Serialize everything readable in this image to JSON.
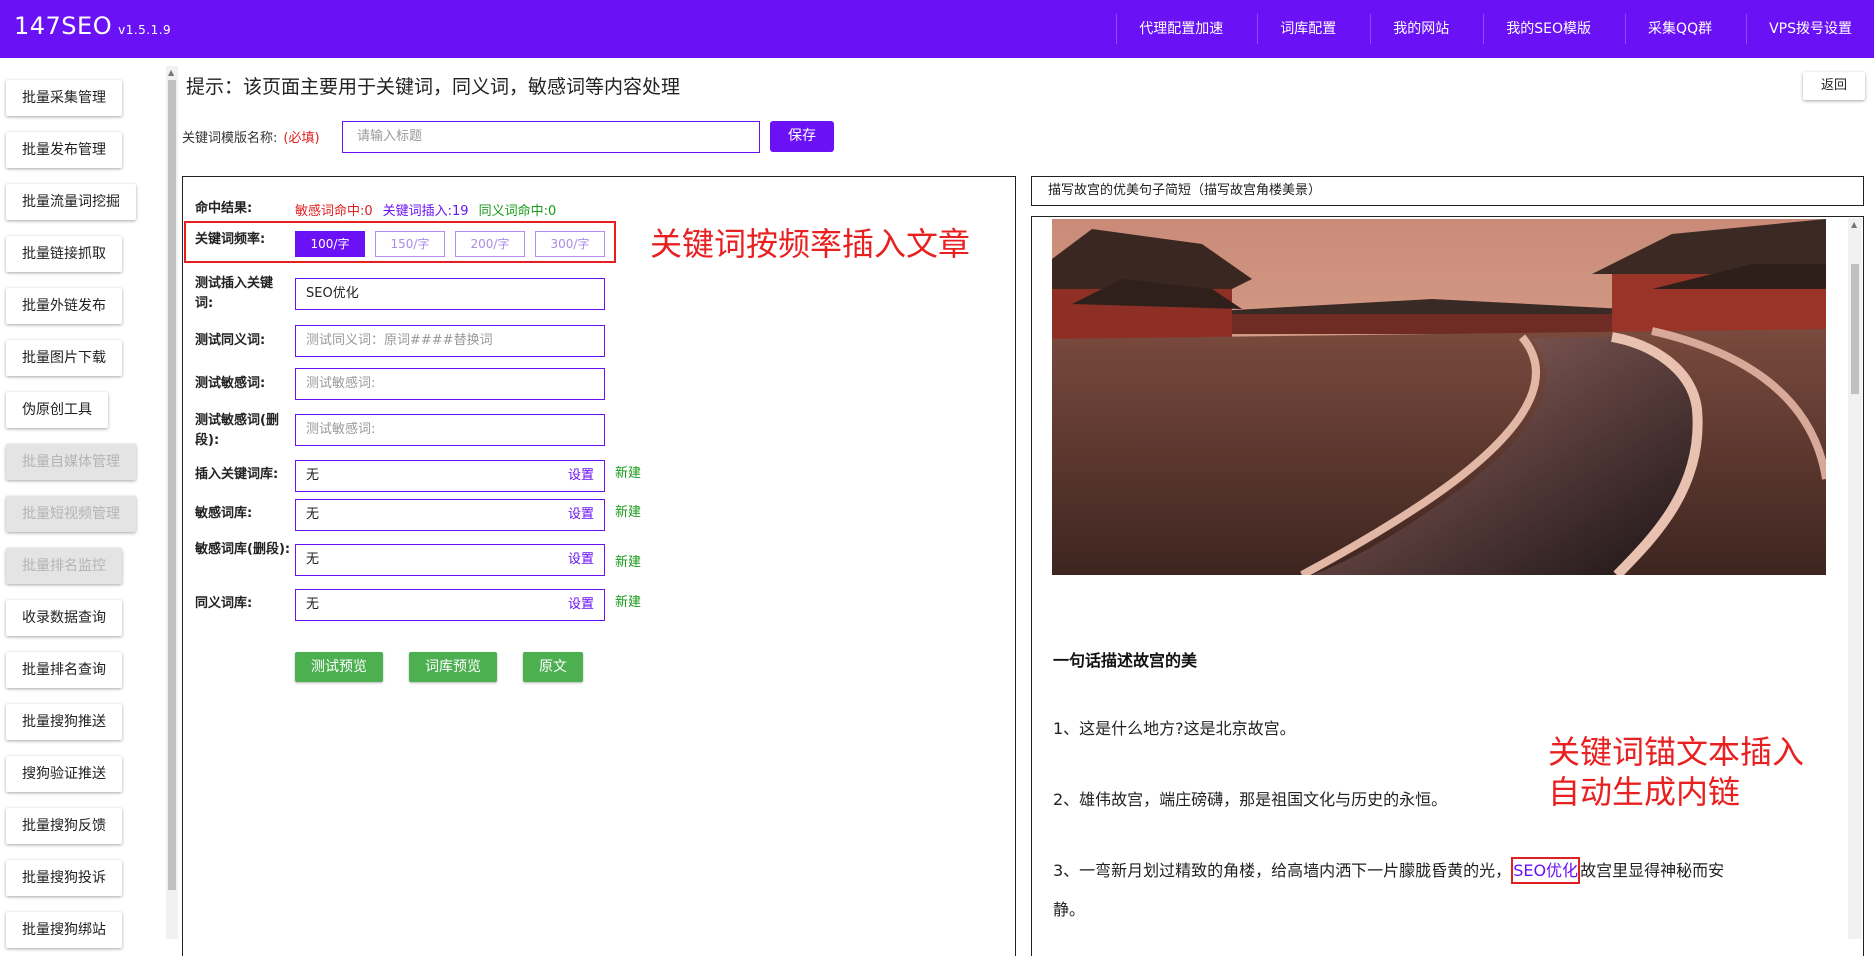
{
  "header": {
    "brand": "147SEO",
    "version": "v1.5.1.9",
    "nav": [
      "代理配置加速",
      "词库配置",
      "我的网站",
      "我的SEO模版",
      "采集QQ群",
      "VPS拨号设置"
    ]
  },
  "sidebar": {
    "items": [
      {
        "label": "批量采集管理",
        "enabled": true
      },
      {
        "label": "批量发布管理",
        "enabled": true
      },
      {
        "label": "批量流量词挖掘",
        "enabled": true
      },
      {
        "label": "批量链接抓取",
        "enabled": true
      },
      {
        "label": "批量外链发布",
        "enabled": true
      },
      {
        "label": "批量图片下载",
        "enabled": true
      },
      {
        "label": "伪原创工具",
        "enabled": true
      },
      {
        "label": "批量自媒体管理",
        "enabled": false
      },
      {
        "label": "批量短视频管理",
        "enabled": false
      },
      {
        "label": "批量排名监控",
        "enabled": false
      },
      {
        "label": "收录数据查询",
        "enabled": true
      },
      {
        "label": "批量排名查询",
        "enabled": true
      },
      {
        "label": "批量搜狗推送",
        "enabled": true
      },
      {
        "label": "搜狗验证推送",
        "enabled": true
      },
      {
        "label": "批量搜狗反馈",
        "enabled": true
      },
      {
        "label": "批量搜狗投诉",
        "enabled": true
      },
      {
        "label": "批量搜狗绑站",
        "enabled": true
      }
    ]
  },
  "page": {
    "hint": "提示：该页面主要用于关键词，同义词，敏感词等内容处理",
    "back_label": "返回",
    "template_name_label": "关键词模版名称:",
    "required_label": "(必填)",
    "template_name_placeholder": "请输入标题",
    "save_label": "保存"
  },
  "form": {
    "hit_label": "命中结果:",
    "hit_sensitive": "敏感词命中:0",
    "hit_keyword": "关键词插入:19",
    "hit_synonym": "同义词命中:0",
    "freq_label": "关键词频率:",
    "freq_options": [
      "100/字",
      "150/字",
      "200/字",
      "300/字"
    ],
    "freq_selected": "100/字",
    "test_keyword_label": "测试插入关键词:",
    "test_keyword_value": "SEO优化",
    "test_synonym_label": "测试同义词:",
    "test_synonym_placeholder": "测试同义词：原词####替换词",
    "test_sensitive_label": "测试敏感词:",
    "test_sensitive_placeholder": "测试敏感词:",
    "test_sensitive_del_label": "测试敏感词(删段):",
    "test_sensitive_del_placeholder": "测试敏感词:",
    "insert_lib_label": "插入关键词库:",
    "sensitive_lib_label": "敏感词库:",
    "sensitive_del_lib_label": "敏感词库(删段):",
    "synonym_lib_label": "同义词库:",
    "lib_value": "无",
    "set_label": "设置",
    "new_label": "新建",
    "btn_test_preview": "测试预览",
    "btn_lib_preview": "词库预览",
    "btn_original": "原文"
  },
  "annotations": {
    "freq_note": "关键词按频率插入文章",
    "anchor_note_1": "关键词锚文本插入",
    "anchor_note_2": "自动生成内链"
  },
  "article": {
    "title": "描写故宫的优美句子简短（描写故宫角楼美景）",
    "heading": "一句话描述故宫的美",
    "p1": "1、这是什么地方?这是北京故宫。",
    "p2": "2、雄伟故宫，端庄磅礴，那是祖国文化与历史的永恒。",
    "p3_before": "3、一弯新月划过精致的角楼，给高墙内洒下一片朦胧昏黄的光，",
    "p3_link": "SEO优化",
    "p3_after": "故宫里显得神秘而安",
    "p3_cont": "静。"
  },
  "colors": {
    "brand_purple": "#6a11f5",
    "annotation_red": "#e82020",
    "success_green": "#4caf50"
  }
}
